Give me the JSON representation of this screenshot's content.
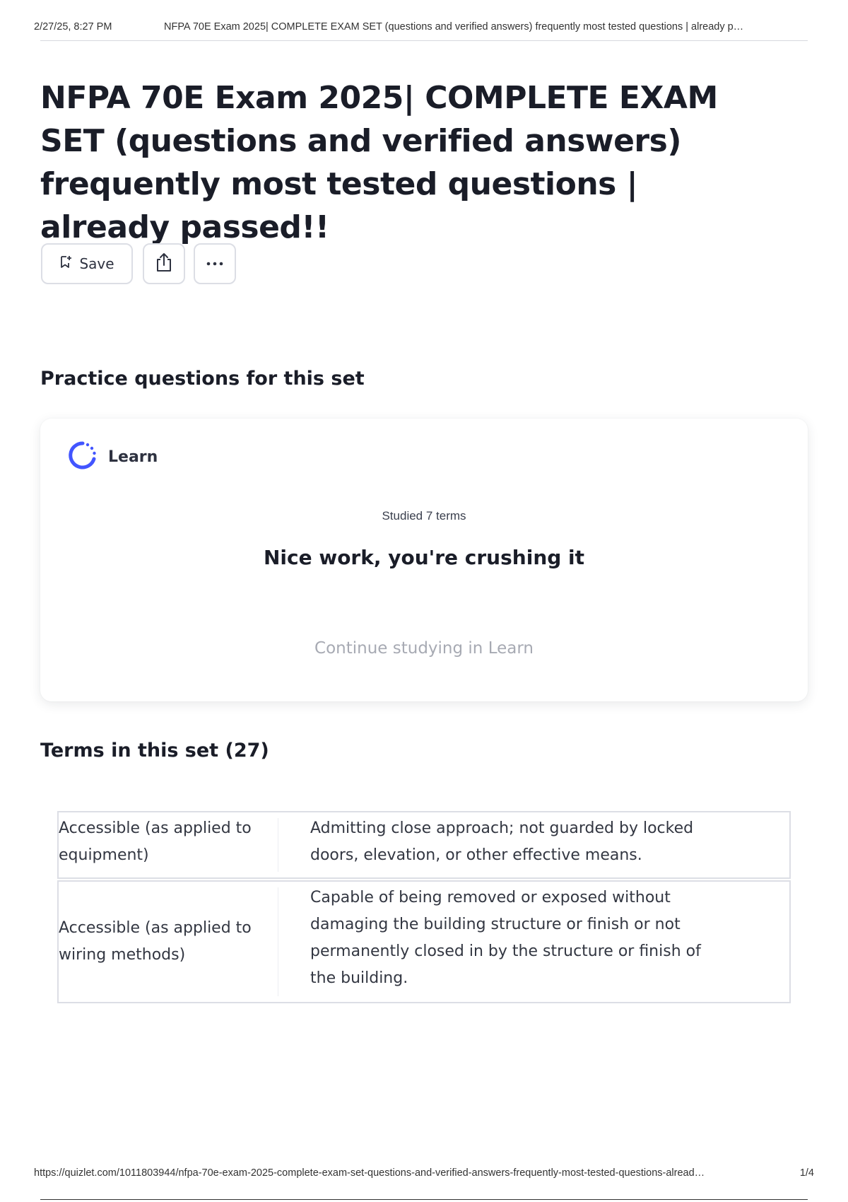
{
  "print_header": {
    "date": "2/27/25, 8:27 PM",
    "doc_title": "NFPA 70E Exam 2025| COMPLETE EXAM SET (questions and verified answers) frequently most tested questions | already p…"
  },
  "page": {
    "title": "NFPA 70E Exam 2025| COMPLETE EXAM SET (questions and verified answers) frequently most tested questions | already passed!!"
  },
  "toolbar": {
    "save_label": "Save",
    "save_icon": "bookmark-add-icon",
    "share_icon": "share-icon",
    "more_icon": "more-horizontal-icon"
  },
  "practice": {
    "heading": "Practice questions for this set",
    "mode_label": "Learn",
    "mode_icon": "learn-progress-icon",
    "studied_text": "Studied 7 terms",
    "encouragement": "Nice work, you're crushing it",
    "continue_label": "Continue studying in Learn",
    "accent_color": "#4255ff"
  },
  "terms": {
    "heading": "Terms in this set (27)",
    "rows": [
      {
        "term": "Accessible (as applied to equipment)",
        "definition": "Admitting close approach; not guarded by locked doors, elevation, or other effective means."
      },
      {
        "term": "Accessible (as applied to wiring methods)",
        "definition": "Capable of being removed or exposed without damaging the building structure or finish or not permanently closed in by the structure or finish of the building."
      }
    ]
  },
  "print_footer": {
    "url": "https://quizlet.com/1011803944/nfpa-70e-exam-2025-complete-exam-set-questions-and-verified-answers-frequently-most-tested-questions-alread…",
    "page_number": "1/4"
  }
}
